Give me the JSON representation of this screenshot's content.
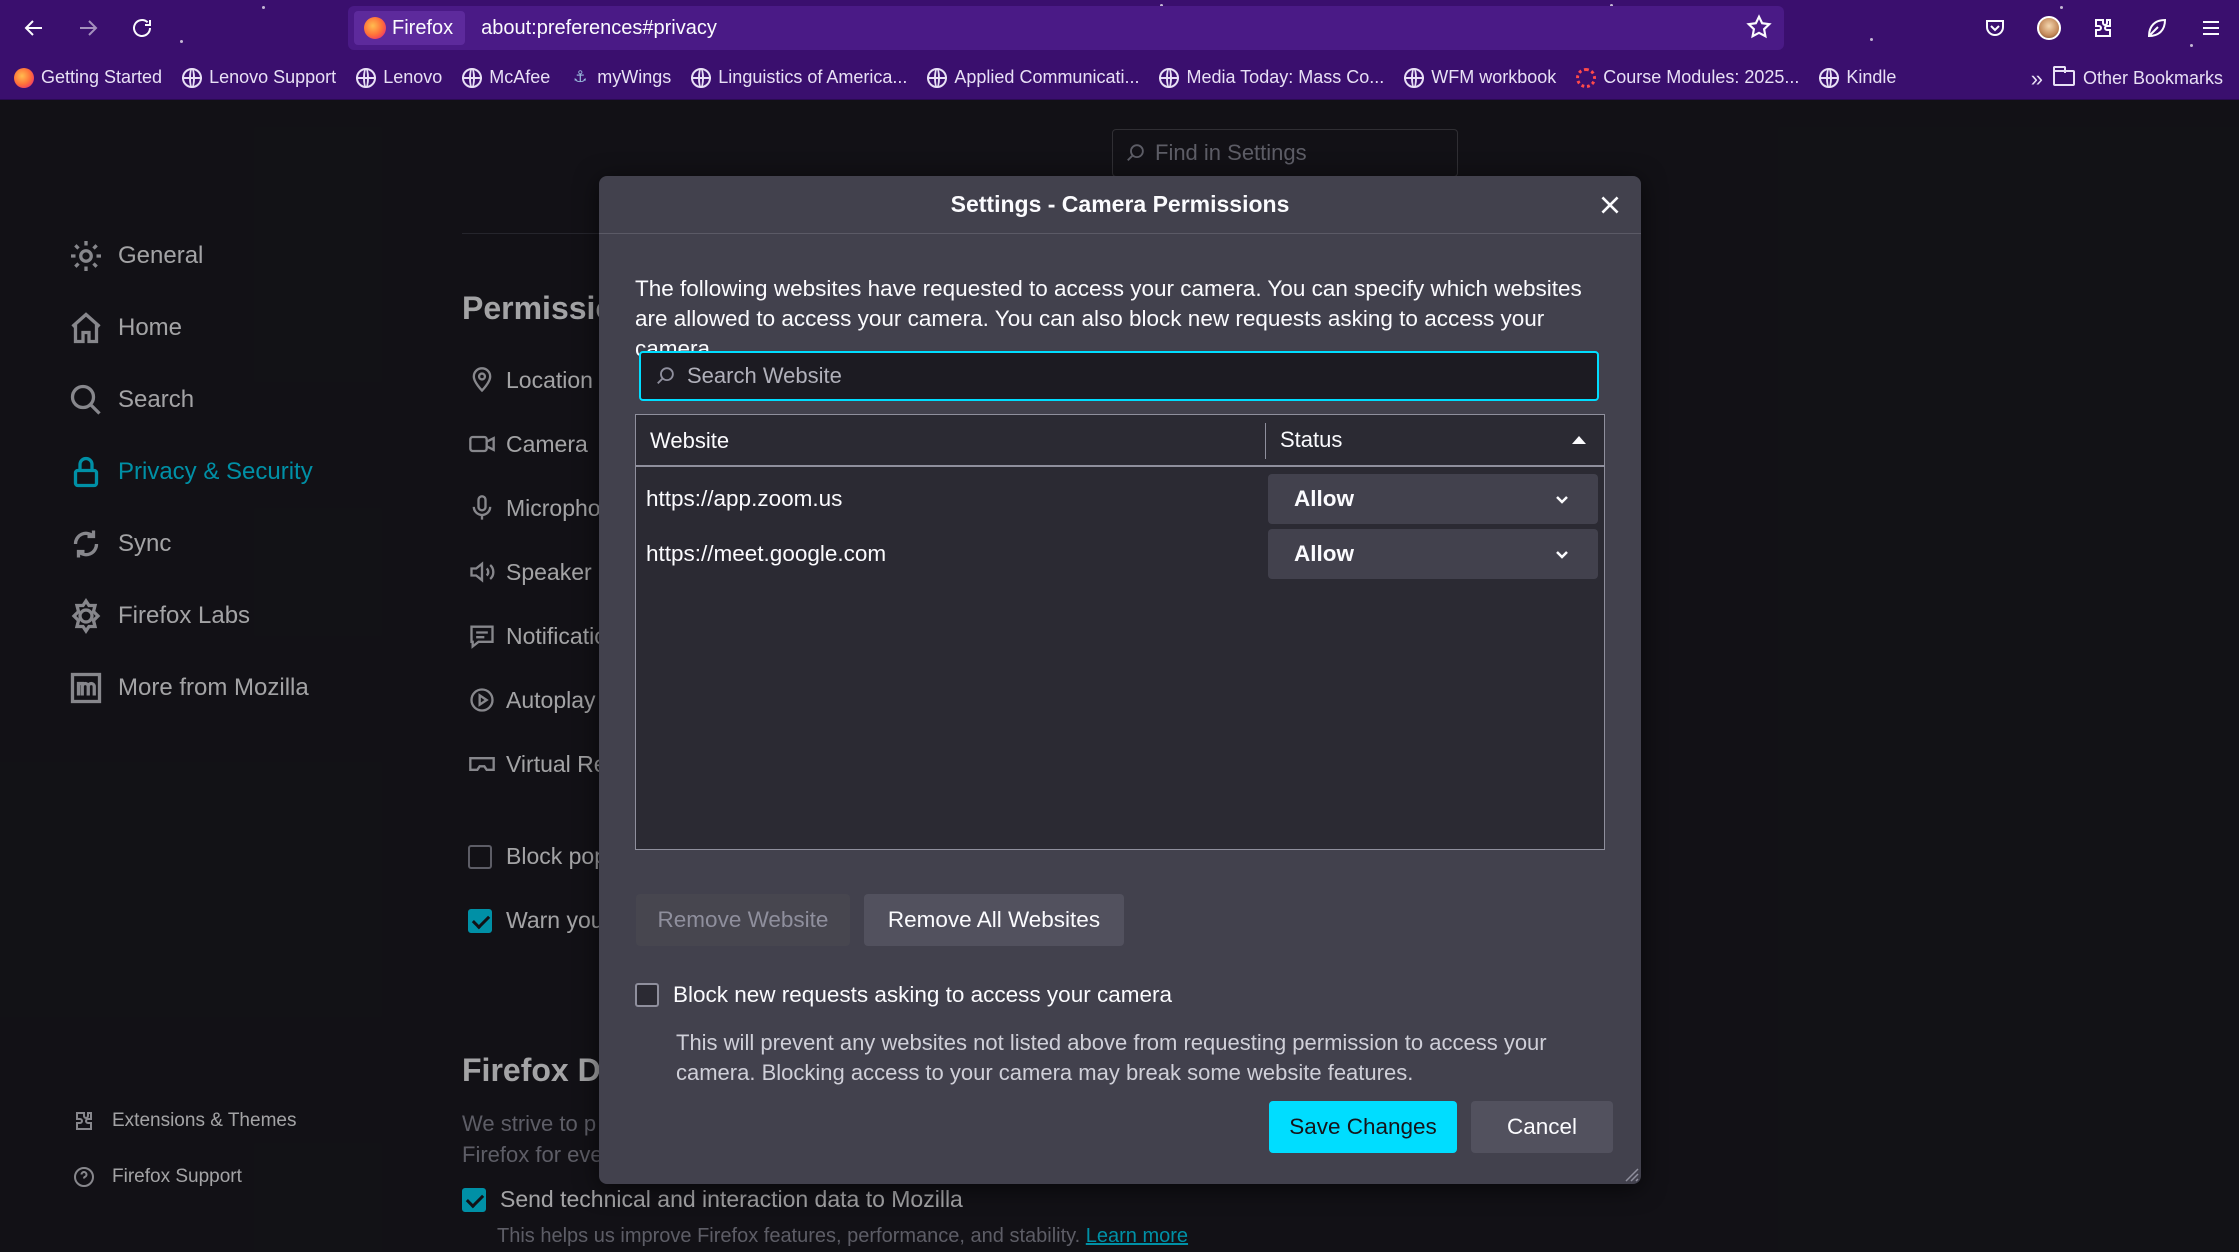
{
  "browser": {
    "identity_label": "Firefox",
    "url": "about:preferences#privacy",
    "bookmarks": [
      {
        "label": "Getting Started",
        "icon": "firefox-icon"
      },
      {
        "label": "Lenovo Support",
        "icon": "globe-icon"
      },
      {
        "label": "Lenovo",
        "icon": "globe-icon"
      },
      {
        "label": "McAfee",
        "icon": "globe-icon"
      },
      {
        "label": "myWings",
        "icon": "wings-icon"
      },
      {
        "label": "Linguistics of America...",
        "icon": "globe-icon"
      },
      {
        "label": "Applied Communicati...",
        "icon": "globe-icon"
      },
      {
        "label": "Media Today: Mass Co...",
        "icon": "globe-icon"
      },
      {
        "label": "WFM workbook",
        "icon": "globe-icon"
      },
      {
        "label": "Course Modules: 2025...",
        "icon": "course-icon"
      },
      {
        "label": "Kindle",
        "icon": "globe-icon"
      }
    ],
    "other_bookmarks": "Other Bookmarks",
    "more_chevron": "»"
  },
  "settings": {
    "find_placeholder": "Find in Settings",
    "categories": [
      {
        "label": "General",
        "icon": "gear-icon"
      },
      {
        "label": "Home",
        "icon": "home-icon"
      },
      {
        "label": "Search",
        "icon": "search-icon"
      },
      {
        "label": "Privacy & Security",
        "icon": "lock-icon",
        "selected": true
      },
      {
        "label": "Sync",
        "icon": "sync-icon"
      },
      {
        "label": "Firefox Labs",
        "icon": "labs-icon"
      },
      {
        "label": "More from Mozilla",
        "icon": "mozilla-icon"
      }
    ],
    "footer": {
      "extensions": "Extensions & Themes",
      "support": "Firefox Support"
    },
    "permissions_title": "Permissio",
    "permissions": [
      {
        "label": "Location"
      },
      {
        "label": "Camera"
      },
      {
        "label": "Micropho"
      },
      {
        "label": "Speaker S"
      },
      {
        "label": "Notificatic"
      },
      {
        "label": "Autoplay"
      },
      {
        "label": "Virtual Re"
      }
    ],
    "block_popups": "Block pop",
    "warn_you": "Warn you",
    "data_title": "Firefox D",
    "data_text_1": "We strive to p",
    "data_text_2": "Firefox for eve",
    "send_data": "Send technical and interaction data to Mozilla",
    "send_help": "This helps us improve Firefox features, performance, and stability.",
    "learn_more": "Learn more"
  },
  "dialog": {
    "title": "Settings - Camera Permissions",
    "description": "The following websites have requested to access your camera. You can specify which websites are allowed to access your camera. You can also block new requests asking to access your camera.",
    "search_placeholder": "Search Website",
    "columns": {
      "website": "Website",
      "status": "Status"
    },
    "rows": [
      {
        "site": "https://app.zoom.us",
        "status": "Allow"
      },
      {
        "site": "https://meet.google.com",
        "status": "Allow"
      }
    ],
    "remove_website": "Remove Website",
    "remove_all": "Remove All Websites",
    "block_label": "Block new requests asking to access your camera",
    "block_desc": "This will prevent any websites not listed above from requesting permission to access your camera. Blocking access to your camera may break some website features.",
    "save": "Save Changes",
    "cancel": "Cancel"
  }
}
